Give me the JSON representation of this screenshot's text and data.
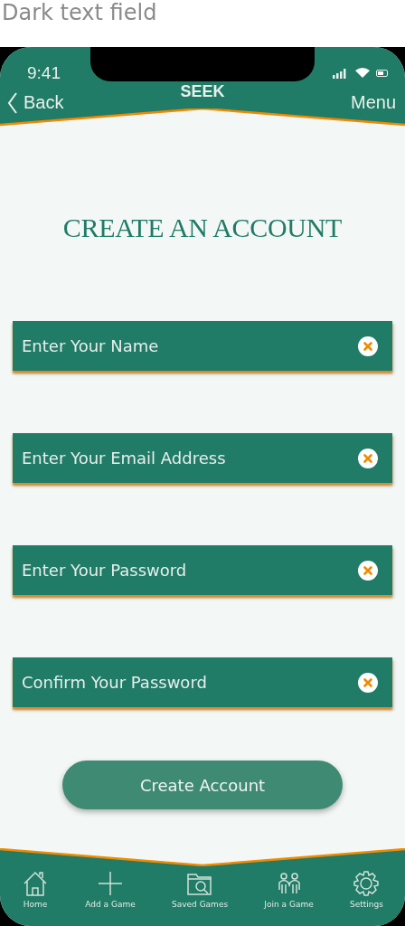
{
  "caption": "Dark text field",
  "status_bar": {
    "time": "9:41"
  },
  "nav": {
    "back": "Back",
    "title": "SEEK",
    "menu": "Menu"
  },
  "heading": "CREATE AN ACCOUNT",
  "fields": [
    {
      "placeholder": "Enter Your Name"
    },
    {
      "placeholder": "Enter Your Email Address"
    },
    {
      "placeholder": "Enter Your Password"
    },
    {
      "placeholder": "Confirm Your Password"
    }
  ],
  "submit": "Create Account",
  "tabs": [
    {
      "label": "Home",
      "kind": "home"
    },
    {
      "label": "Add a Game",
      "kind": "plus"
    },
    {
      "label": "Saved Games",
      "kind": "folder"
    },
    {
      "label": "Join a Game",
      "kind": "people"
    },
    {
      "label": "Settings",
      "kind": "gear"
    }
  ]
}
